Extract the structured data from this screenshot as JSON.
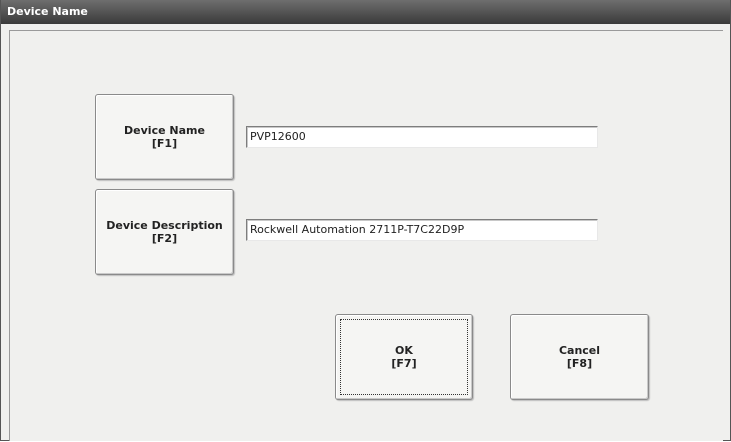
{
  "window": {
    "title": "Device Name"
  },
  "device_name": {
    "button_label": "Device Name",
    "button_key": "[F1]",
    "value": "PVP12600"
  },
  "device_description": {
    "button_label": "Device Description",
    "button_key": "[F2]",
    "value": "Rockwell Automation 2711P-T7C22D9P"
  },
  "actions": {
    "ok_label": "OK",
    "ok_key": "[F7]",
    "cancel_label": "Cancel",
    "cancel_key": "[F8]"
  }
}
